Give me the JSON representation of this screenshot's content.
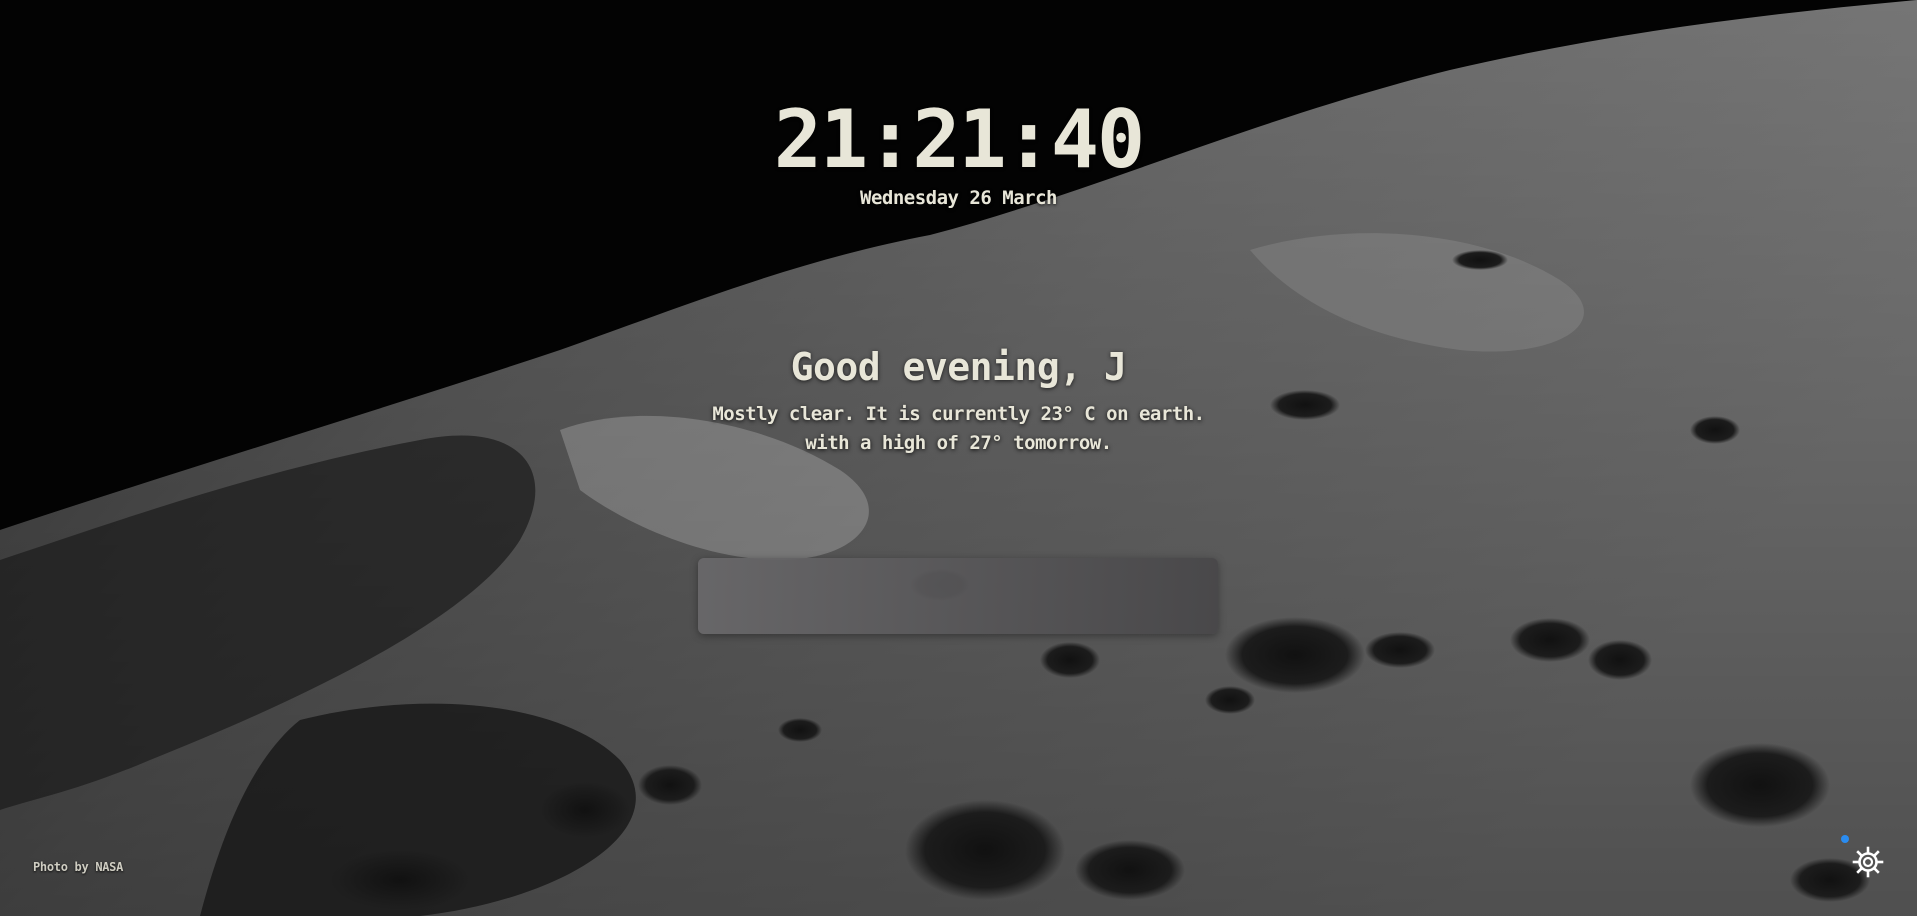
{
  "clock": {
    "time": "21:21:40",
    "date": "Wednesday 26 March"
  },
  "greeting": {
    "text": "Good evening, J"
  },
  "weather": {
    "line1": "Mostly clear. It is currently 23° C on earth.",
    "line2": "with a high of 27° tomorrow."
  },
  "search": {
    "value": "",
    "placeholder": ""
  },
  "footer": {
    "photo_credit": "Photo by NASA"
  },
  "icons": {
    "settings": "gear-icon",
    "notification": "notification-dot-icon"
  },
  "colors": {
    "text": "#e8e6d8",
    "dot": "#2a8cf0",
    "search_bg": "#5e5d5f"
  }
}
